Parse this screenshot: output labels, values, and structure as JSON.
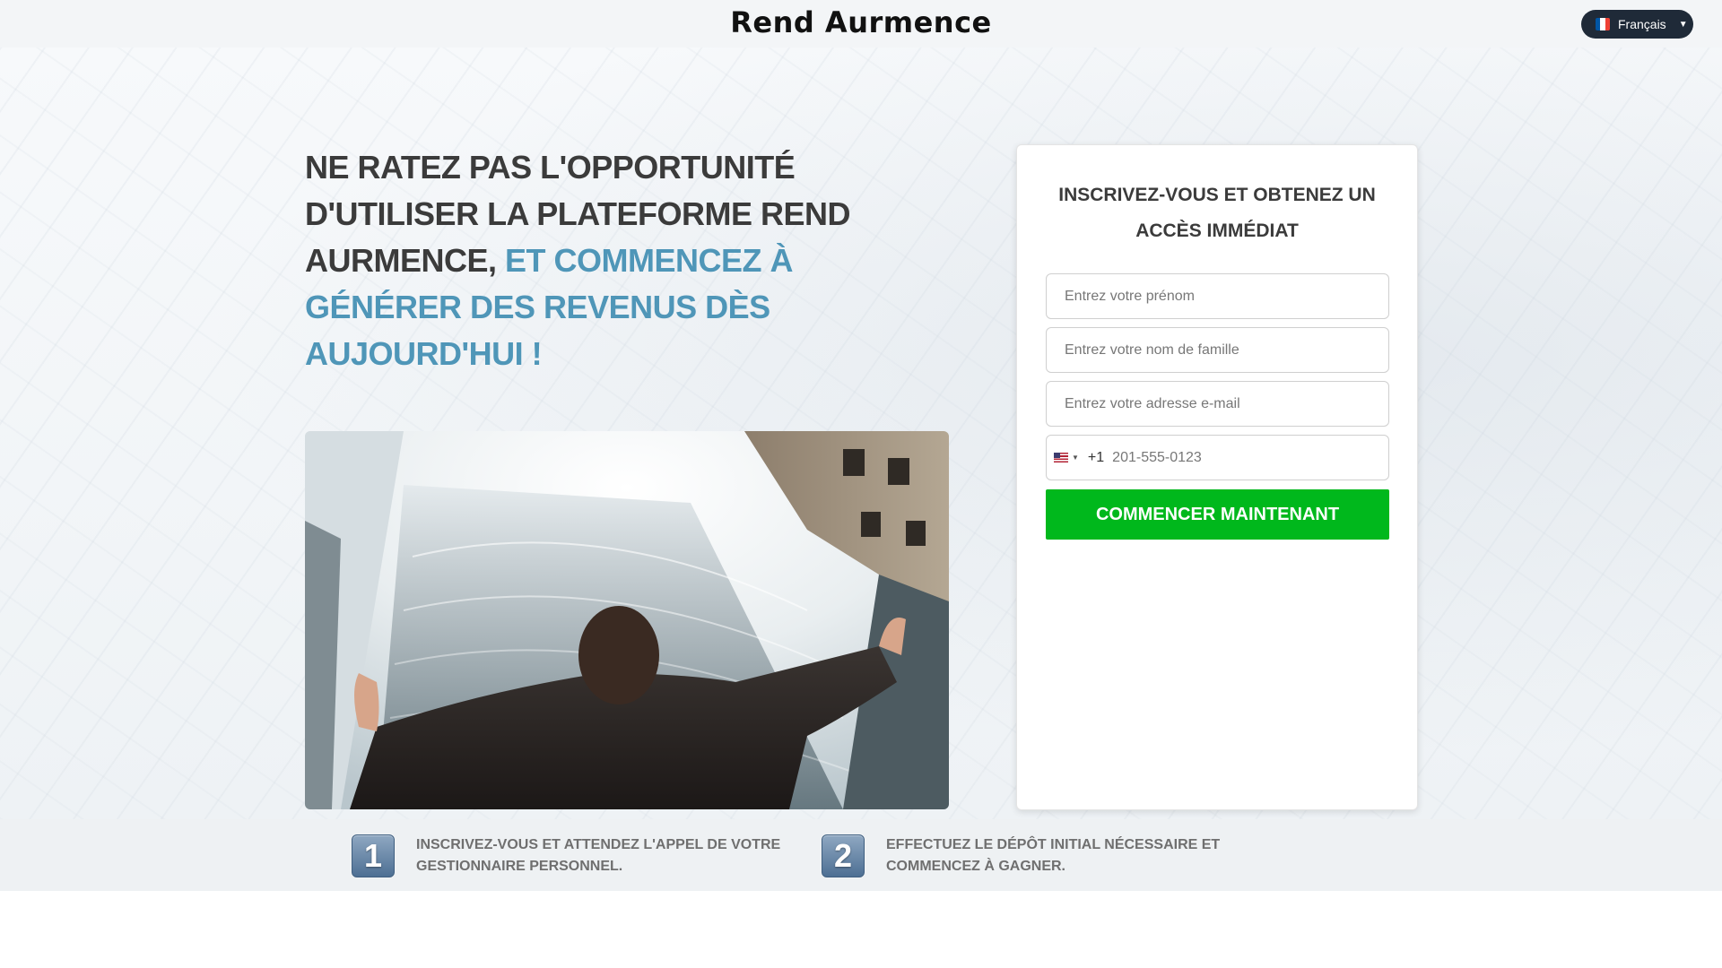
{
  "header": {
    "brand": "Rend Aurmence",
    "language": {
      "label": "Français",
      "flag_icon": "france-flag-icon"
    }
  },
  "hero": {
    "headline_main": "NE RATEZ PAS L'OPPORTUNITÉ D'UTILISER LA PLATEFORME REND AURMENCE,",
    "headline_accent": "ET COMMENCEZ À GÉNÉRER DES REVENUS DÈS AUJOURD'HUI !",
    "colors": {
      "text": "#3b3b3b",
      "accent": "#4f96b8"
    }
  },
  "form": {
    "title": "INSCRIVEZ-VOUS ET OBTENEZ UN ACCÈS IMMÉDIAT",
    "first_name_placeholder": "Entrez votre prénom",
    "last_name_placeholder": "Entrez votre nom de famille",
    "email_placeholder": "Entrez votre adresse e-mail",
    "phone": {
      "country_icon": "us-flag-icon",
      "dial_code": "+1",
      "placeholder": "201-555-0123"
    },
    "submit_label": "COMMENCER MAINTENANT",
    "submit_color": "#00b81c"
  },
  "steps": [
    {
      "number": "1",
      "text": "INSCRIVEZ-VOUS ET ATTENDEZ L'APPEL DE VOTRE GESTIONNAIRE PERSONNEL."
    },
    {
      "number": "2",
      "text": "EFFECTUEZ LE DÉPÔT INITIAL NÉCESSAIRE ET COMMENCEZ À GAGNER."
    }
  ]
}
